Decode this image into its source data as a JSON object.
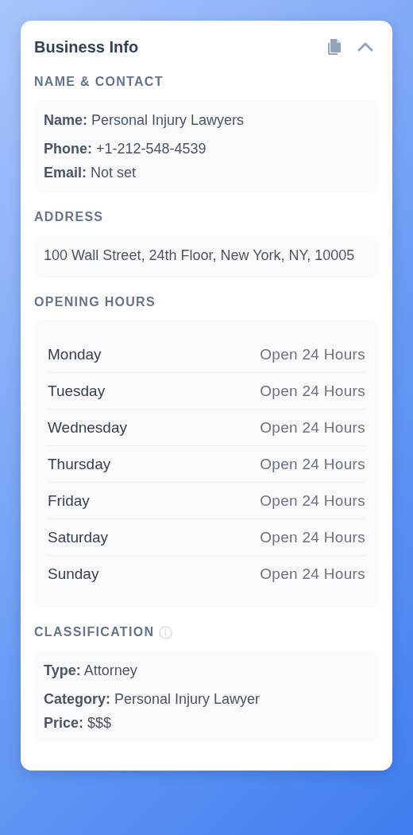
{
  "card": {
    "title": "Business Info"
  },
  "contact": {
    "heading": "NAME & CONTACT",
    "lines": [
      "**Name:** Personal Injury Lawyers",
      "**Phone:** +1-212-548-4539",
      "**Email:** Not set"
    ]
  },
  "address": {
    "heading": "ADDRESS",
    "text": "100 Wall Street, 24th Floor, New York, NY, 10005"
  },
  "hours": {
    "heading": "OPENING HOURS",
    "rows": [
      {
        "day": "Monday",
        "hours": "Open 24 Hours"
      },
      {
        "day": "Tuesday",
        "hours": "Open 24 Hours"
      },
      {
        "day": "Wednesday",
        "hours": "Open 24 Hours"
      },
      {
        "day": "Thursday",
        "hours": "Open 24 Hours"
      },
      {
        "day": "Friday",
        "hours": "Open 24 Hours"
      },
      {
        "day": "Saturday",
        "hours": "Open 24 Hours"
      },
      {
        "day": "Sunday",
        "hours": "Open 24 Hours"
      }
    ]
  },
  "classification": {
    "heading": "CLASSIFICATION",
    "lines": [
      "**Type:** Attorney",
      "**Category:** Personal Injury Lawyer",
      "**Price:** $$$"
    ]
  }
}
